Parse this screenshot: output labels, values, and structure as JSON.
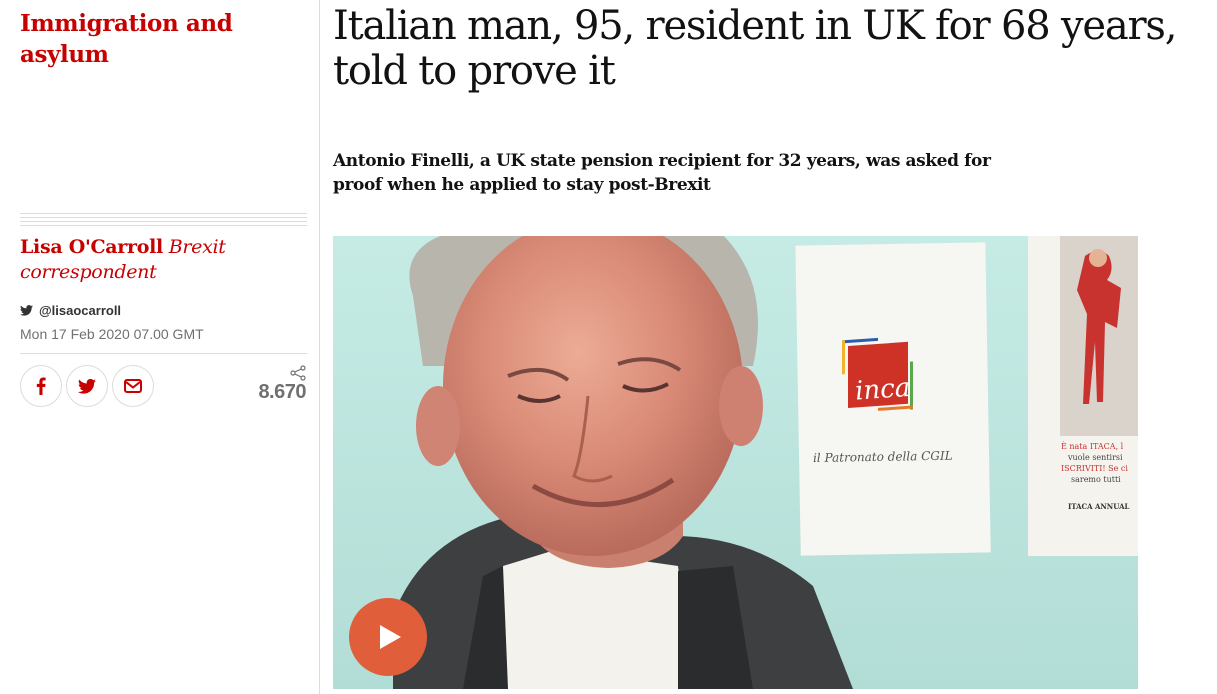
{
  "section": {
    "label": "Immigration and asylum"
  },
  "byline": {
    "author": "Lisa O'Carroll",
    "role": "Brexit correspondent",
    "twitter_handle": "@lisaocarroll",
    "date": "Mon 17 Feb 2020 07.00 GMT"
  },
  "share": {
    "buttons": [
      "facebook-icon",
      "twitter-icon",
      "email-icon"
    ],
    "count": "8.670"
  },
  "article": {
    "headline": "Italian man, 95, resident in UK for 68 years, told to prove it",
    "standfirst": "Antonio Finelli, a UK state pension recipient for 32 years, was asked for proof when he applied to stay post-Brexit"
  },
  "video": {
    "poster_texts": {
      "inca_logo": "inca",
      "inca_caption": "il Patronato della CGIL",
      "itaca_line1": "È nata ITACA, l",
      "itaca_line2": "vuole sentirsi",
      "itaca_line3": "ISCRIVITI! Se ci",
      "itaca_line4": "saremo tutti",
      "itaca_line5": "ITACA ANNUAL"
    }
  },
  "colors": {
    "accent": "#c70000",
    "text": "#121212",
    "muted": "#707070",
    "play": "#e05e3a",
    "wall": "#bfe6e0"
  }
}
